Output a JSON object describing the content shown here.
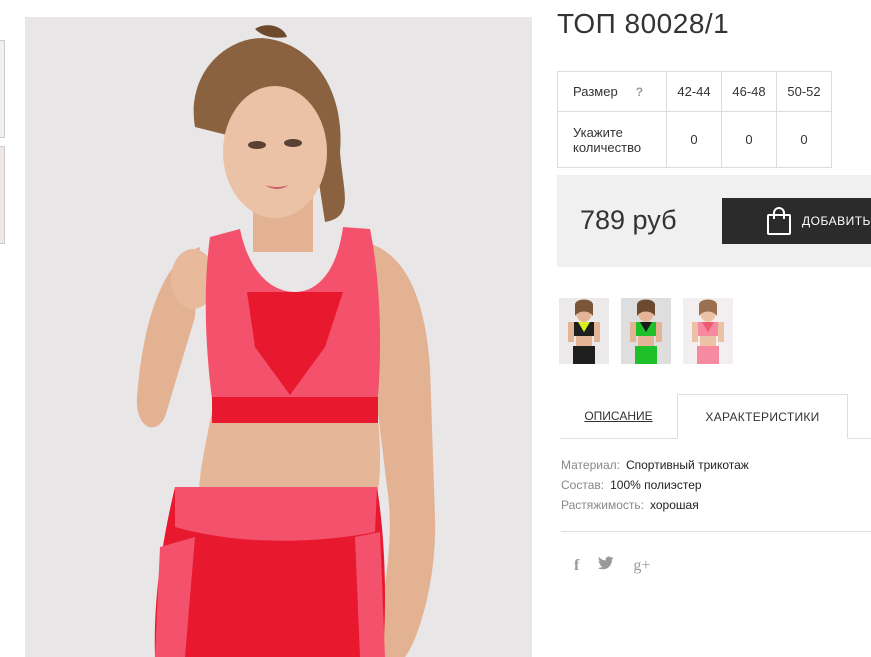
{
  "product": {
    "title": "ТОП 80028/1",
    "price": "789 руб"
  },
  "size_table": {
    "size_label": "Размер",
    "help_mark": "?",
    "sizes": [
      "42-44",
      "46-48",
      "50-52"
    ],
    "qty_label": "Укажите количество",
    "quantities": [
      "0",
      "0",
      "0"
    ]
  },
  "cart": {
    "add_label": "ДОБАВИТЬ",
    "icon": "shopping-bag-icon"
  },
  "tabs": {
    "description": "ОПИСАНИЕ",
    "characteristics": "ХАРАКТЕРИСТИКИ",
    "active": "characteristics"
  },
  "specs": [
    {
      "key": "Материал:",
      "value": "Спортивный трикотаж"
    },
    {
      "key": "Состав:",
      "value": "100% полиэстер"
    },
    {
      "key": "Растяжимость:",
      "value": "хорошая"
    }
  ],
  "social": {
    "facebook": "f",
    "twitter": "twitter-icon",
    "googleplus": "g+"
  },
  "colors": {
    "top_pink": "#f4516c",
    "top_red": "#e8192f",
    "button_bg": "#2b2b2b",
    "price_bg": "#f0f0f0",
    "variant_yellow": "#d8f21c",
    "variant_green": "#1fbf2a",
    "variant_pink": "#f58aa0"
  }
}
